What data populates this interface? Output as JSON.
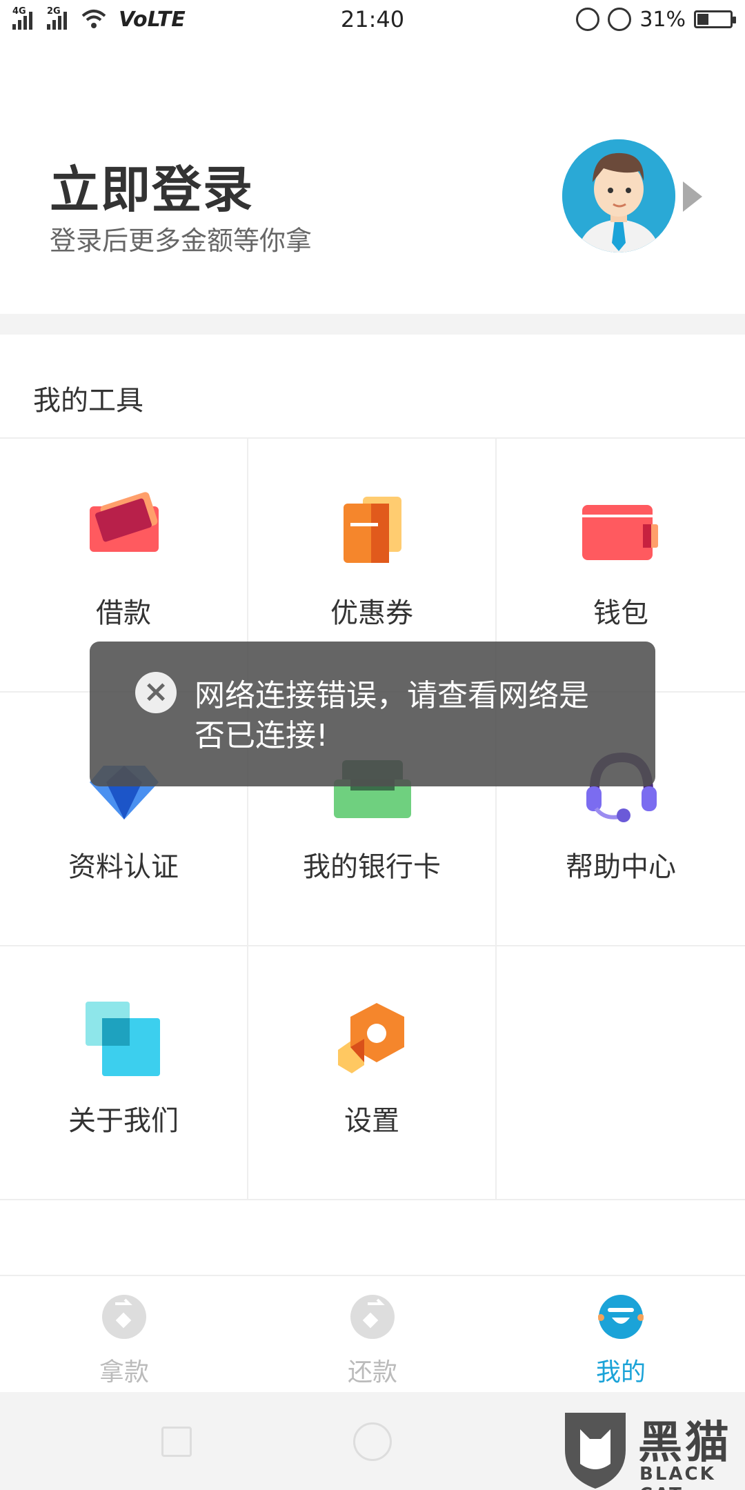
{
  "status_bar": {
    "network_tag_1": "4G",
    "network_tag_2": "2G",
    "volte": "VoLTE",
    "time": "21:40",
    "battery_percent": "31%",
    "battery_level": 0.31
  },
  "header": {
    "title": "立即登录",
    "subtitle": "登录后更多金额等你拿"
  },
  "tools": {
    "section_title": "我的工具",
    "items": [
      {
        "label": "借款",
        "icon": "loan-card-icon"
      },
      {
        "label": "优惠券",
        "icon": "coupon-icon"
      },
      {
        "label": "钱包",
        "icon": "wallet-icon"
      },
      {
        "label": "资料认证",
        "icon": "diamond-icon"
      },
      {
        "label": "我的银行卡",
        "icon": "bank-card-icon"
      },
      {
        "label": "帮助中心",
        "icon": "headset-icon"
      },
      {
        "label": "关于我们",
        "icon": "about-squares-icon"
      },
      {
        "label": "设置",
        "icon": "settings-hexagon-icon"
      }
    ]
  },
  "toast": {
    "message": "网络连接错误，请查看网络是否已连接!",
    "icon": "close-circle-icon"
  },
  "tabbar": {
    "tabs": [
      {
        "label": "拿款",
        "icon": "borrow-tab-icon"
      },
      {
        "label": "还款",
        "icon": "repay-tab-icon"
      },
      {
        "label": "我的",
        "icon": "mine-tab-icon"
      }
    ],
    "active_color": "#1ba3d8",
    "inactive_color": "#bbbbbb"
  },
  "watermark": {
    "cn": "黑猫",
    "en": "BLACK CAT"
  }
}
